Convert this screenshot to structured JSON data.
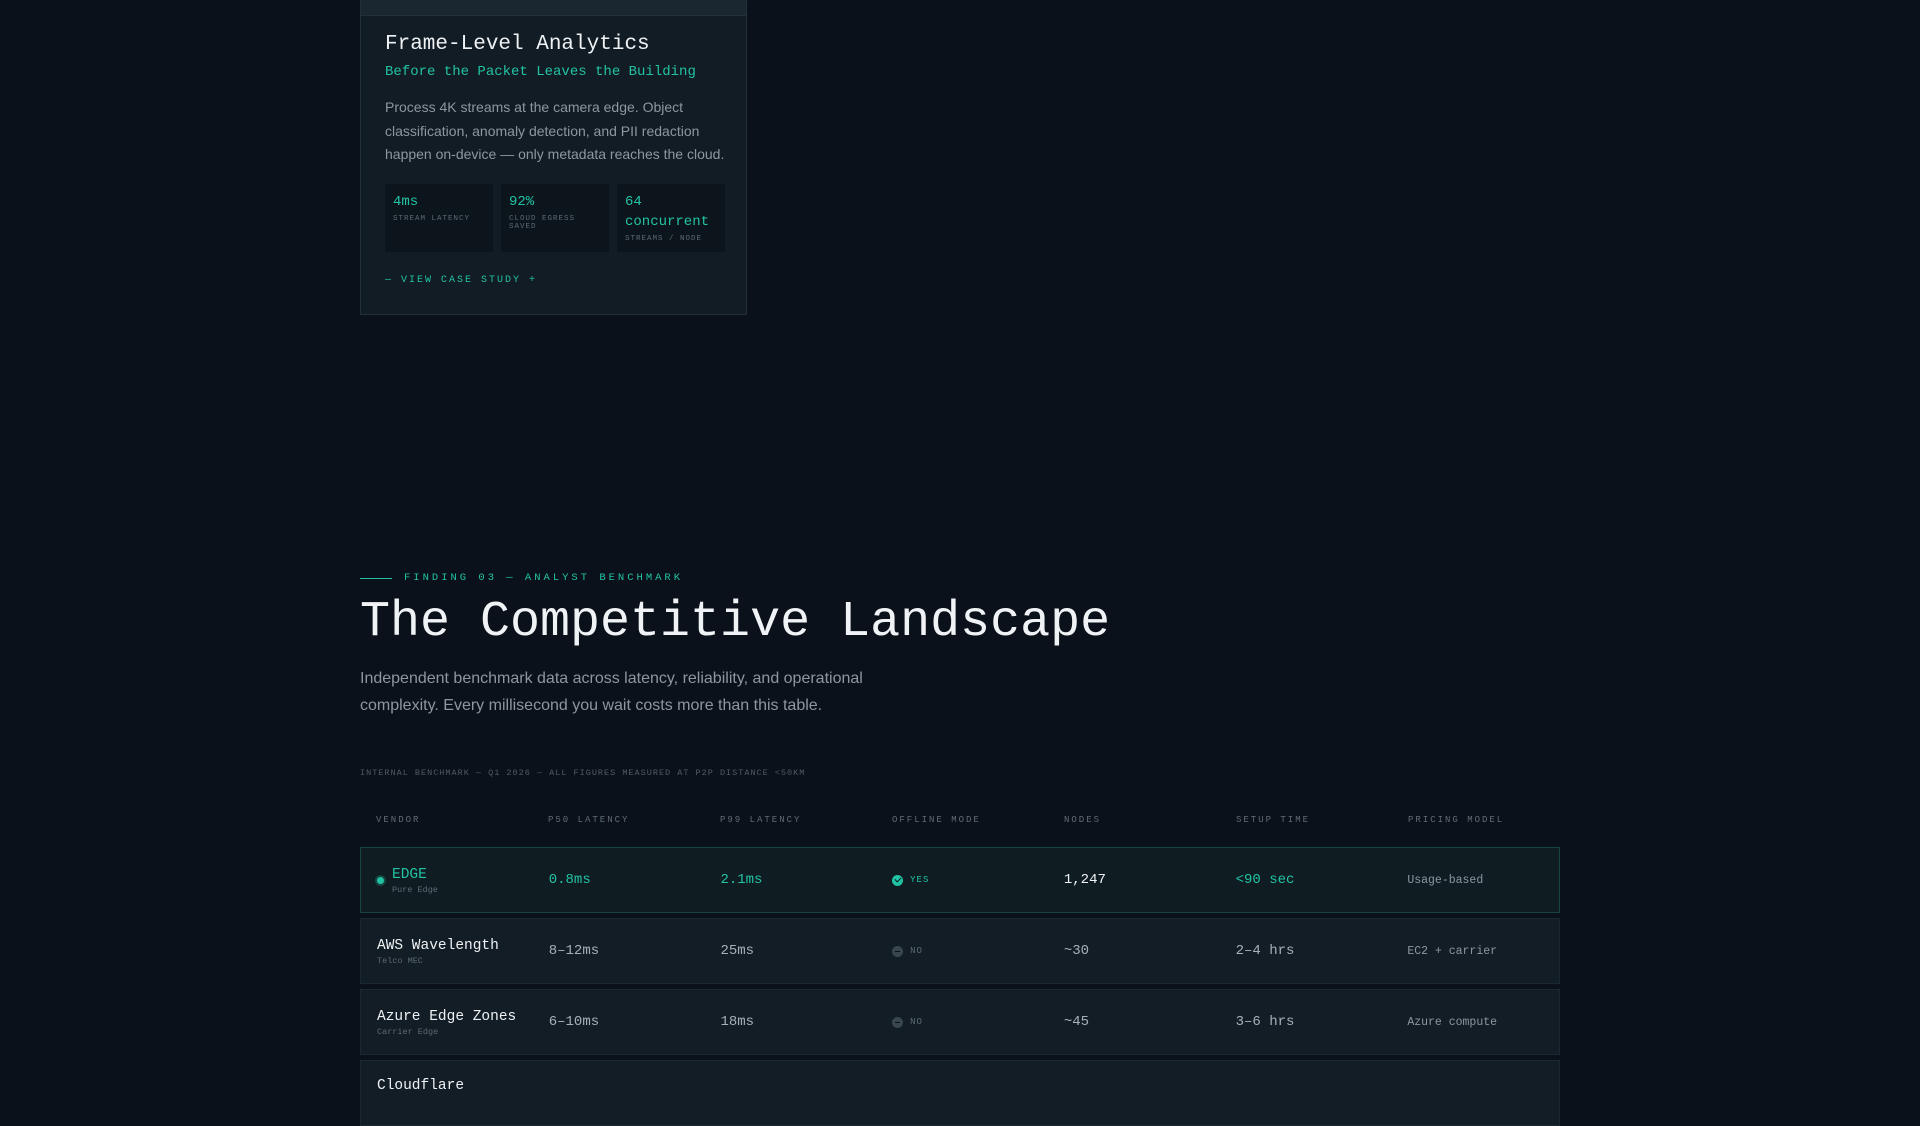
{
  "case_card": {
    "title": "Frame-Level Analytics",
    "subtitle": "Before the Packet Leaves the Building",
    "description": "Process 4K streams at the camera edge. Object classification, anomaly detection, and PII redaction happen on-device — only metadata reaches the cloud.",
    "stats": [
      {
        "value": "4ms",
        "label": "STREAM LATENCY"
      },
      {
        "value": "92%",
        "label": "CLOUD EGRESS SAVED"
      },
      {
        "value": "64 concurrent",
        "label": "STREAMS / NODE"
      }
    ],
    "link_label": "— VIEW CASE STUDY +"
  },
  "section": {
    "eyebrow": "FINDING 03 — ANALYST BENCHMARK",
    "title": "The Competitive Landscape",
    "description": "Independent benchmark data across latency, reliability, and operational complexity. Every millisecond you wait costs more than this table.",
    "note": "INTERNAL BENCHMARK — Q1 2026 — ALL FIGURES MEASURED AT P2P DISTANCE <50KM"
  },
  "table": {
    "headers": [
      "VENDOR",
      "P50 LATENCY",
      "P99 LATENCY",
      "OFFLINE MODE",
      "NODES",
      "SETUP TIME",
      "PRICING MODEL"
    ],
    "rows": [
      {
        "vendor": "EDGE",
        "sub": "Pure Edge",
        "p50": "0.8ms",
        "p99": "2.1ms",
        "offline": "YES",
        "nodes": "1,247",
        "setup": "<90 sec",
        "pricing": "Usage-based"
      },
      {
        "vendor": "AWS Wavelength",
        "sub": "Telco MEC",
        "p50": "8–12ms",
        "p99": "25ms",
        "offline": "NO",
        "nodes": "~30",
        "setup": "2–4 hrs",
        "pricing": "EC2 + carrier"
      },
      {
        "vendor": "Azure Edge Zones",
        "sub": "Carrier Edge",
        "p50": "6–10ms",
        "p99": "18ms",
        "offline": "NO",
        "nodes": "~45",
        "setup": "3–6 hrs",
        "pricing": "Azure compute"
      },
      {
        "vendor": "Cloudflare"
      }
    ]
  }
}
